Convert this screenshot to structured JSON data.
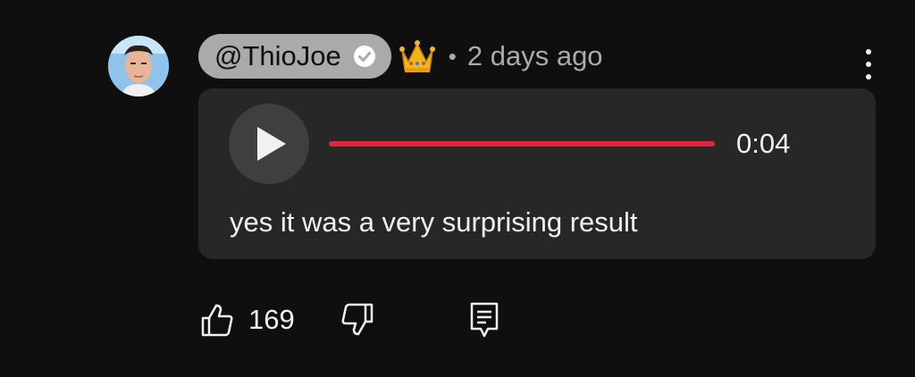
{
  "comment": {
    "author": "@ThioJoe",
    "author_verified": true,
    "badge_icon": "crown-icon",
    "separator": "•",
    "timestamp": "2 days ago",
    "audio": {
      "duration": "0:04",
      "progress_fraction": 1.0,
      "progress_color": "#e0273a"
    },
    "text": "yes it was a very surprising result",
    "likes": "169"
  },
  "icons": {
    "more": "more-vert-icon",
    "play": "play-icon",
    "like": "thumbs-up-icon",
    "dislike": "thumbs-down-icon",
    "reply": "reply-icon"
  },
  "colors": {
    "background": "#0f0f0f",
    "card": "#272727",
    "name_pill": "#aaaaaa",
    "accent": "#e0273a"
  }
}
